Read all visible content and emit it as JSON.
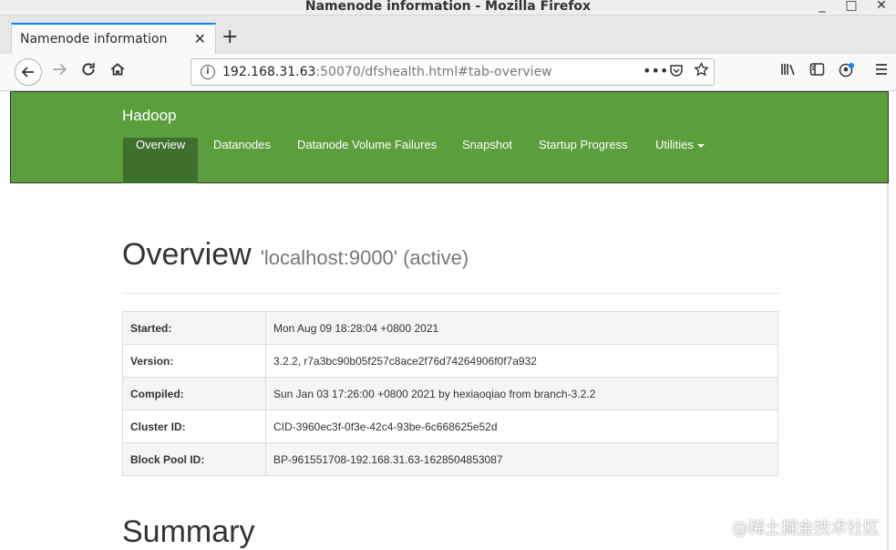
{
  "window": {
    "title": "Namenode information - Mozilla Firefox",
    "minimize": "_",
    "maximize": "□",
    "close": "✕"
  },
  "tabs": {
    "active_label": "Namenode information",
    "close_glyph": "✕",
    "new_tab_glyph": "+"
  },
  "navbar": {
    "url_host": "192.168.31.63",
    "url_rest": ":50070/dfshealth.html#tab-overview",
    "page_actions": "•••"
  },
  "icons": {
    "back": "back-arrow-icon",
    "forward": "forward-arrow-icon",
    "reload": "reload-icon",
    "home": "home-icon",
    "info": "info-icon",
    "pocket": "pocket-icon",
    "bookmark": "star-icon",
    "library": "library-icon",
    "sidebar": "sidebar-icon",
    "account": "account-icon",
    "menu": "hamburger-menu-icon"
  },
  "site": {
    "brand": "Hadoop",
    "nav": [
      {
        "label": "Overview"
      },
      {
        "label": "Datanodes"
      },
      {
        "label": "Datanode Volume Failures"
      },
      {
        "label": "Snapshot"
      },
      {
        "label": "Startup Progress"
      },
      {
        "label": "Utilities"
      }
    ]
  },
  "overview": {
    "heading": "Overview",
    "host": "'localhost:9000' (active)",
    "rows": [
      {
        "key": "Started:",
        "value": "Mon Aug 09 18:28:04 +0800 2021"
      },
      {
        "key": "Version:",
        "value": "3.2.2, r7a3bc90b05f257c8ace2f76d74264906f0f7a932"
      },
      {
        "key": "Compiled:",
        "value": "Sun Jan 03 17:26:00 +0800 2021 by hexiaoqiao from branch-3.2.2"
      },
      {
        "key": "Cluster ID:",
        "value": "CID-3960ec3f-0f3e-42c4-93be-6c668625e52d"
      },
      {
        "key": "Block Pool ID:",
        "value": "BP-961551708-192.168.31.63-1628504853087"
      }
    ]
  },
  "summary": {
    "heading": "Summary"
  },
  "watermark": "@稀土掘金技术社区",
  "colors": {
    "header_green": "#5a9e3e",
    "active_nav": "#3f6f2c",
    "tab_accent": "#0a84ff"
  }
}
